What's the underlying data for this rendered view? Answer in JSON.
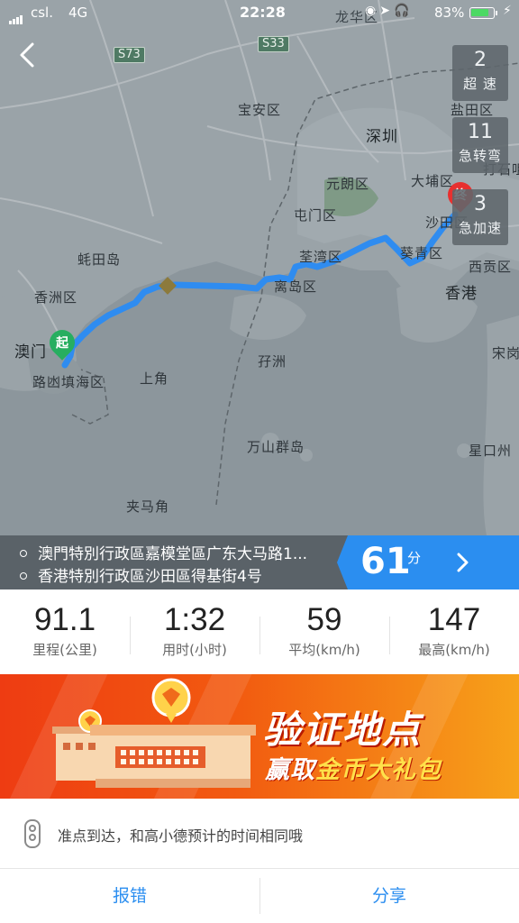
{
  "status_bar": {
    "carrier": "csl.",
    "network": "4G",
    "time": "22:28",
    "battery_pct": "83%",
    "battery_level": 0.83
  },
  "map": {
    "labels": [
      "龙华区",
      "宝安区",
      "盐田区",
      "深圳",
      "元朗区",
      "大埔区",
      "屯门区",
      "沙田区",
      "荃湾区",
      "葵青区",
      "西贡区",
      "香港",
      "蚝田岛",
      "香洲区",
      "澳门",
      "路凼填海区",
      "上角",
      "离岛区",
      "孖洲",
      "万山群岛",
      "星口州",
      "夹马角",
      "宋岗",
      "打石咀"
    ],
    "road_shields": [
      "S73",
      "S33"
    ],
    "start_marker": "起",
    "end_marker": "终"
  },
  "events": [
    {
      "count": "2",
      "label": "超 速"
    },
    {
      "count": "11",
      "label": "急转弯"
    },
    {
      "count": "3",
      "label": "急加速"
    }
  ],
  "route": {
    "from": "澳門特別行政區嘉模堂區广东大马路1...",
    "to": "香港特別行政區沙田區得基街4号",
    "duration_value": "61",
    "duration_unit": "分"
  },
  "stats": [
    {
      "value": "91.1",
      "label": "里程(公里)"
    },
    {
      "value": "1:32",
      "label": "用时(小时)"
    },
    {
      "value": "59",
      "label": "平均(km/h)"
    },
    {
      "value": "147",
      "label": "最高(km/h)"
    }
  ],
  "banner": {
    "title": "验证地点",
    "sub_white_1": "赢取",
    "sub_yellow": "金币大礼包"
  },
  "tip": {
    "text": "准点到达，和高小德预计的时间相同哦"
  },
  "footer": {
    "report": "报错",
    "share": "分享"
  },
  "colors": {
    "accent": "#2b8ef0",
    "route_line": "#2f8cf0",
    "start_marker": "#27ae60",
    "end_marker": "#e8302f"
  }
}
